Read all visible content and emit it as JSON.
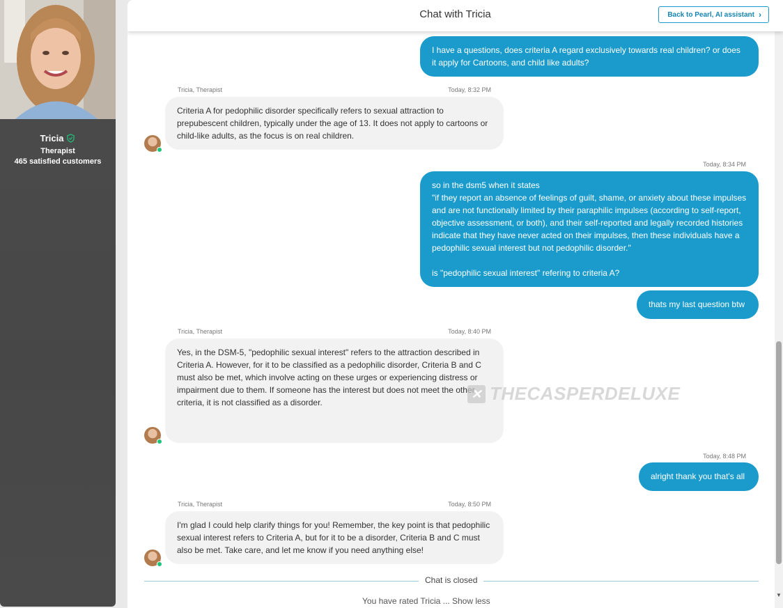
{
  "therapist": {
    "name": "Tricia",
    "role": "Therapist",
    "stat": "465 satisfied customers"
  },
  "header": {
    "title": "Chat with Tricia",
    "back_label": "Back to Pearl, AI assistant"
  },
  "messages": [
    {
      "from": "user",
      "text": "I have a questions, does criteria A regard exclusively towards real children? or does it apply for Cartoons, and child like adults?"
    },
    {
      "from": "bot",
      "sender": "Tricia, Therapist",
      "time": "Today, 8:32 PM",
      "text": "Criteria A for pedophilic disorder specifically refers to sexual attraction to prepubescent children, typically under the age of 13. It does not apply to cartoons or child-like adults, as the focus is on real children."
    },
    {
      "from": "user",
      "time": "Today, 8:34 PM",
      "line1": "so in the dsm5 when it states",
      "line2": "\"if they report an absence of feelings of guilt, shame, or anxiety about these impulses and are not functionally limited by their paraphilic impulses (according to self-report, objective assessment, or both), and their self-reported and legally recorded histories indicate that they have never acted on their impulses, then these individuals have a pedophilic sexual interest but not pedophilic disorder.\"",
      "line3": "is \"pedophilic sexual interest\" refering to criteria A?"
    },
    {
      "from": "user",
      "text": "thats my last question btw"
    },
    {
      "from": "bot",
      "sender": "Tricia, Therapist",
      "time": "Today, 8:40 PM",
      "text": "Yes, in the DSM-5, \"pedophilic sexual interest\" refers to the attraction described in Criteria A. However, for it to be classified as a pedophilic disorder, Criteria B and C must also be met, which involve acting on these urges or experiencing distress or impairment due to them. If someone has the interest but does not meet the other criteria, it is not classified as a disorder."
    },
    {
      "from": "user",
      "time": "Today, 8:48 PM",
      "text": "alright thank you that's all"
    },
    {
      "from": "bot",
      "sender": "Tricia, Therapist",
      "time": "Today, 8:50 PM",
      "text": "I'm glad I could help clarify things for you! Remember, the key point is that pedophilic sexual interest refers to Criteria A, but for it to be a disorder, Criteria B and C must also be met. Take care, and let me know if you need anything else!"
    }
  ],
  "closed_label": "Chat is closed",
  "cutoff_text": "You have rated Tricia ... Show less",
  "watermark": "THECASPERDELUXE",
  "colors": {
    "accent": "#1a9bcc",
    "bot_bubble": "#f2f2f2",
    "online": "#1ec47a"
  }
}
